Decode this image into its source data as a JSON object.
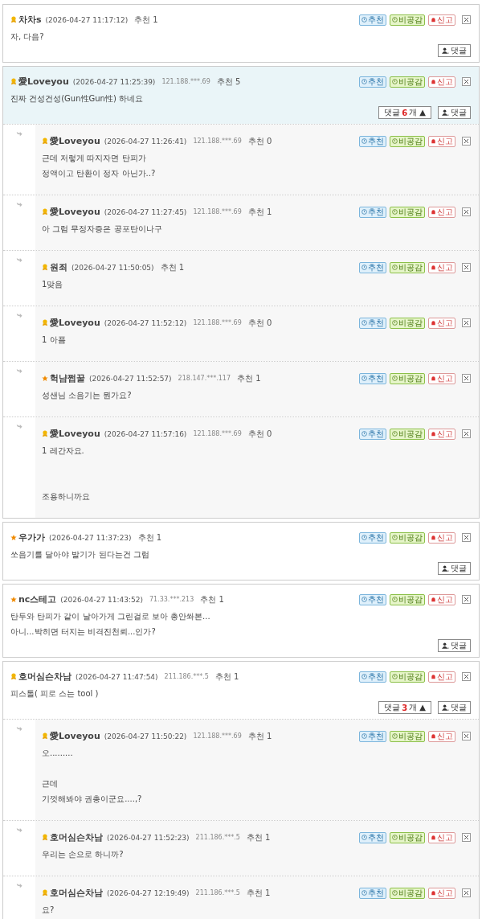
{
  "threads": [
    {
      "comment": {
        "kind": "medal",
        "author": "차차s",
        "date": "(2026-04-27 11:17:12)",
        "recommend": "추천 1",
        "body": "자, 다음?",
        "highlighted": false,
        "actions": [
          "추천",
          "비공감",
          "신고"
        ]
      },
      "reply_button": "댓글"
    },
    {
      "comment": {
        "kind": "medal",
        "author": "愛Loveyou",
        "date": "(2026-04-27 11:25:39)",
        "ip": "121.188.***.69",
        "recommend": "추천 5",
        "body": "진짜 건성건성(Gun性Gun性) 하네요",
        "highlighted": true,
        "actions": [
          "추천",
          "비공감",
          "신고"
        ]
      },
      "toggle": {
        "label": "댓글",
        "count": "6",
        "suffix": "개 ▲"
      },
      "reply_button": "댓글",
      "replies": [
        {
          "kind": "medal",
          "author": "愛Loveyou",
          "date": "(2026-04-27 11:26:41)",
          "ip": "121.188.***.69",
          "recommend": "추천 0",
          "body": "근데 저렇게 따지자면 탄피가\n정액이고 탄환이 정자 아닌가..?",
          "actions": [
            "추천",
            "비공감",
            "신고"
          ]
        },
        {
          "kind": "medal",
          "author": "愛Loveyou",
          "date": "(2026-04-27 11:27:45)",
          "ip": "121.188.***.69",
          "recommend": "추천 1",
          "body": "아 그럼 무정자증은 공포탄이나구",
          "actions": [
            "추천",
            "비공감",
            "신고"
          ]
        },
        {
          "kind": "medal",
          "author": "원죄",
          "date": "(2026-04-27 11:50:05)",
          "recommend": "추천 1",
          "body": "1맞음",
          "actions": [
            "추천",
            "비공감",
            "신고"
          ]
        },
        {
          "kind": "medal",
          "author": "愛Loveyou",
          "date": "(2026-04-27 11:52:12)",
          "ip": "121.188.***.69",
          "recommend": "추천 0",
          "body": "1 아픔",
          "actions": [
            "추천",
            "비공감",
            "신고"
          ]
        },
        {
          "kind": "star",
          "author": "헉냠쩝꿀",
          "date": "(2026-04-27 11:52:57)",
          "ip": "218.147.***.117",
          "recommend": "추천 1",
          "body": "성샌님 소음기는 뭔가요?",
          "actions": [
            "추천",
            "비공감",
            "신고"
          ]
        },
        {
          "kind": "medal",
          "author": "愛Loveyou",
          "date": "(2026-04-27 11:57:16)",
          "ip": "121.188.***.69",
          "recommend": "추천 0",
          "body": "1   레간자요.\n\n\n조용하니까요",
          "actions": [
            "추천",
            "비공감",
            "신고"
          ]
        }
      ]
    },
    {
      "comment": {
        "kind": "star",
        "author": "우가가",
        "date": "(2026-04-27 11:37:23)",
        "recommend": "추천 1",
        "body": "쏘음기를 달아야 발기가 된다는건 그럼",
        "highlighted": false,
        "actions": [
          "추천",
          "비공감",
          "신고"
        ]
      },
      "reply_button": "댓글"
    },
    {
      "comment": {
        "kind": "star",
        "author": "nc스테고",
        "date": "(2026-04-27 11:43:52)",
        "ip": "71.33.***.213",
        "recommend": "추천 1",
        "body": "탄두와 탄피가 같이 날아가게 그린걸로 보아 총안쏴본...\n아니...박히면 터지는 비격진천뢰...인가?",
        "highlighted": false,
        "actions": [
          "추천",
          "비공감",
          "신고"
        ]
      },
      "reply_button": "댓글"
    },
    {
      "comment": {
        "kind": "medal",
        "author": "호머심슨차남",
        "date": "(2026-04-27 11:47:54)",
        "ip": "211.186.***.5",
        "recommend": "추천 1",
        "body": "피스톨( 피로 스는 tool )",
        "highlighted": false,
        "actions": [
          "추천",
          "비공감",
          "신고"
        ]
      },
      "toggle": {
        "label": "댓글",
        "count": "3",
        "suffix": "개 ▲"
      },
      "reply_button": "댓글",
      "replies": [
        {
          "kind": "medal",
          "author": "愛Loveyou",
          "date": "(2026-04-27 11:50:22)",
          "ip": "121.188.***.69",
          "recommend": "추천 1",
          "body": "오.........\n\n근데\n기껏해봐야 권총이군요....,?",
          "actions": [
            "추천",
            "비공감",
            "신고"
          ]
        },
        {
          "kind": "medal",
          "author": "호머심슨차남",
          "date": "(2026-04-27 11:52:23)",
          "ip": "211.186.***.5",
          "recommend": "추천 1",
          "body": "우리는 손으로 하니까?",
          "actions": [
            "추천",
            "비공감",
            "신고"
          ]
        },
        {
          "kind": "medal",
          "author": "호머심슨차남",
          "date": "(2026-04-27 12:19:49)",
          "ip": "211.186.***.5",
          "recommend": "추천 1",
          "body": "요?",
          "actions": [
            "추천",
            "비공감",
            "신고"
          ]
        }
      ]
    }
  ]
}
